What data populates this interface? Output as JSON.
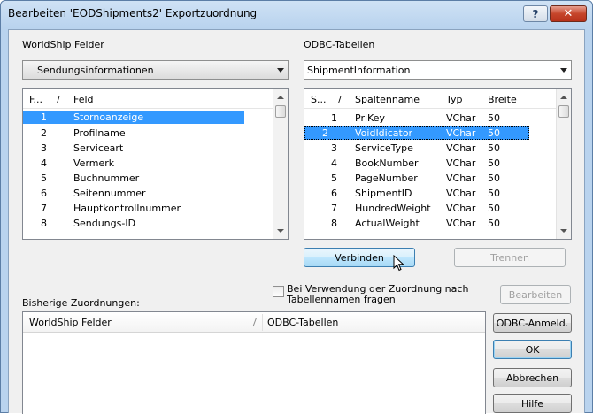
{
  "window": {
    "title": "Bearbeiten 'EODShipments2' Exportzuordnung",
    "help_label": "?",
    "close_label": "✕"
  },
  "left": {
    "label": "WorldShip Felder",
    "combo_value": "Sendungsinformationen",
    "columns": [
      "F...",
      "/",
      "Feld"
    ],
    "rows": [
      {
        "num": "1",
        "name": "Stornoanzeige",
        "selected": true
      },
      {
        "num": "2",
        "name": "Profilname"
      },
      {
        "num": "3",
        "name": "Serviceart"
      },
      {
        "num": "4",
        "name": "Vermerk"
      },
      {
        "num": "5",
        "name": "Buchnummer"
      },
      {
        "num": "6",
        "name": "Seitennummer"
      },
      {
        "num": "7",
        "name": "Hauptkontrollnummer"
      },
      {
        "num": "8",
        "name": "Sendungs-ID"
      }
    ]
  },
  "right": {
    "label": "ODBC-Tabellen",
    "combo_value": "ShipmentInformation",
    "columns": [
      "S...",
      "/",
      "Spaltenname",
      "Typ",
      "Breite"
    ],
    "rows": [
      {
        "num": "1",
        "name": "PriKey",
        "type": "VChar",
        "width": "50"
      },
      {
        "num": "2",
        "name": "VoidIdicator",
        "type": "VChar",
        "width": "50",
        "selected": true
      },
      {
        "num": "3",
        "name": "ServiceType",
        "type": "VChar",
        "width": "50"
      },
      {
        "num": "4",
        "name": "BookNumber",
        "type": "VChar",
        "width": "50"
      },
      {
        "num": "5",
        "name": "PageNumber",
        "type": "VChar",
        "width": "50"
      },
      {
        "num": "6",
        "name": "ShipmentID",
        "type": "VChar",
        "width": "50"
      },
      {
        "num": "7",
        "name": "HundredWeight",
        "type": "VChar",
        "width": "50"
      },
      {
        "num": "8",
        "name": "ActualWeight",
        "type": "VChar",
        "width": "50"
      }
    ]
  },
  "actions": {
    "connect_label": "Verbinden",
    "disconnect_label": "Trennen"
  },
  "mappings": {
    "label": "Bisherige Zuordnungen:",
    "checkbox_label_line1": "Bei Verwendung der Zuordnung nach",
    "checkbox_label_line2": "Tabellennamen fragen",
    "col_worldship": "WorldShip Felder",
    "col_odbc": "ODBC-Tabellen"
  },
  "buttons": {
    "edit": "Bearbeiten",
    "odbc_login": "ODBC-Anmeld.",
    "ok": "OK",
    "cancel": "Abbrechen",
    "help": "Hilfe"
  }
}
